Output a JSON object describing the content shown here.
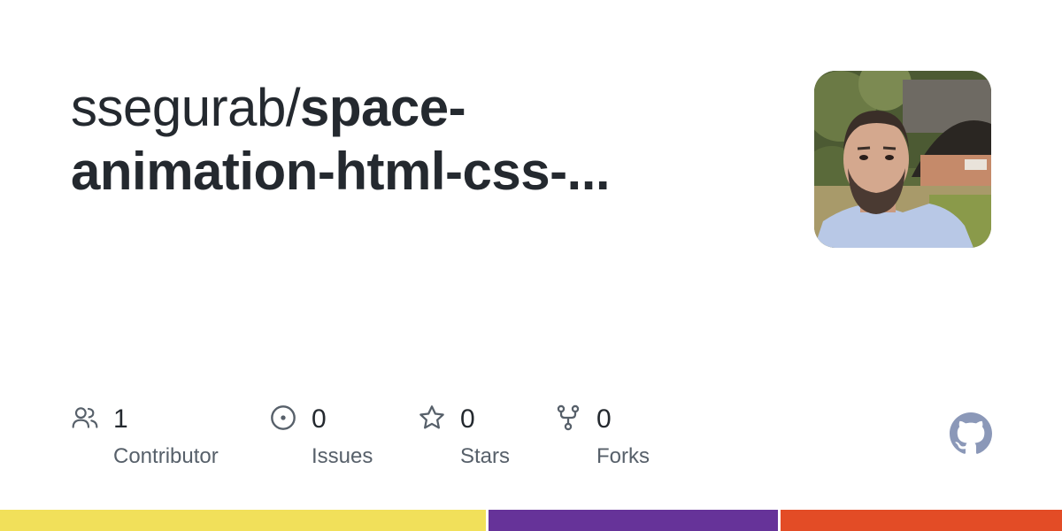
{
  "repo": {
    "owner": "ssegurab/",
    "name_line1": "space-",
    "name_line2": "animation-html-css-..."
  },
  "avatar": {
    "alt": "ssegurab avatar"
  },
  "stats": [
    {
      "icon": "contributors-icon",
      "count": "1",
      "label": "Contributor"
    },
    {
      "icon": "issues-icon",
      "count": "0",
      "label": "Issues"
    },
    {
      "icon": "star-icon",
      "count": "0",
      "label": "Stars"
    },
    {
      "icon": "fork-icon",
      "count": "0",
      "label": "Forks"
    }
  ],
  "logo": {
    "icon": "github-logo-icon"
  },
  "language_bar": [
    {
      "color": "#f1e05a",
      "share": 0.46
    },
    {
      "color": "#663399",
      "share": 0.275
    },
    {
      "color": "#e34c26",
      "share": 0.265
    }
  ],
  "colors": {
    "text": "#24292f",
    "muted": "#57606a",
    "icon": "#57606a",
    "logo": "#8b98b8"
  }
}
